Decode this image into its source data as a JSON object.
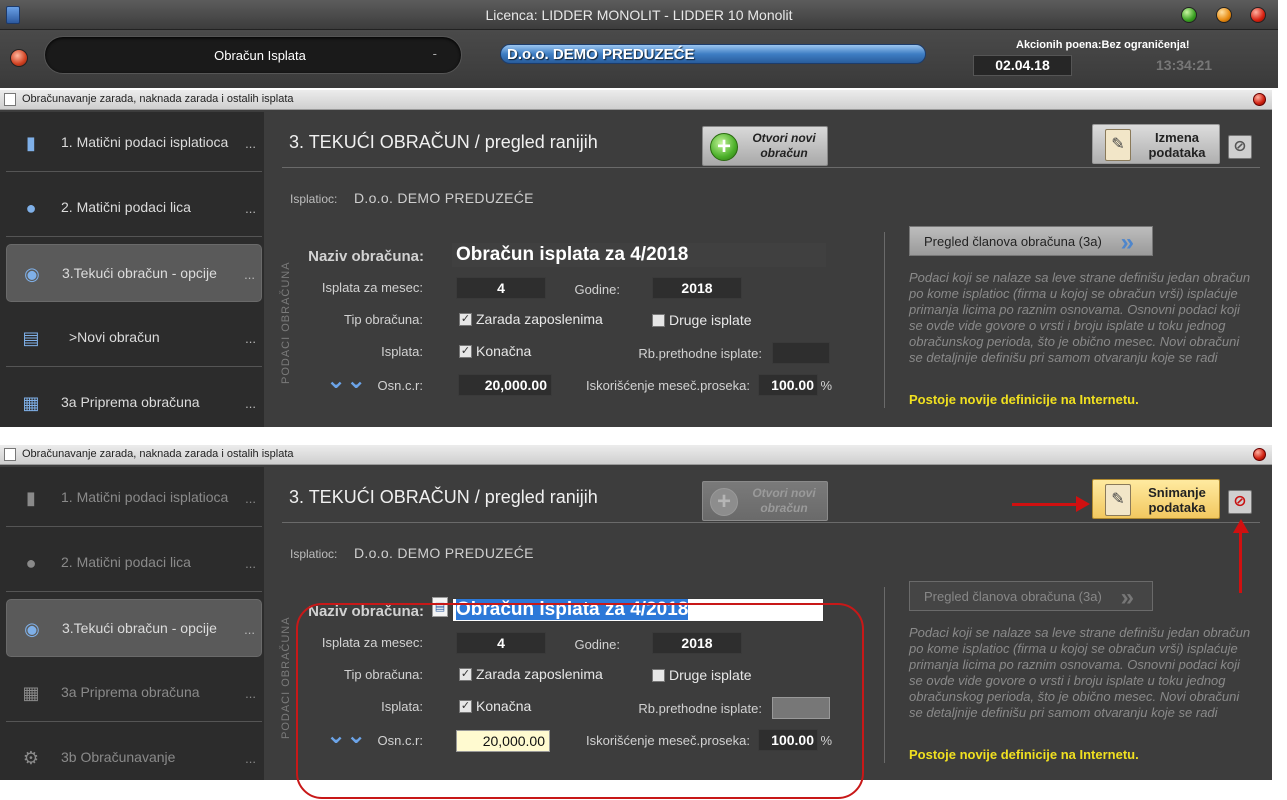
{
  "app": {
    "title": "Licenca: LIDDER MONOLIT - LIDDER 10 Monolit",
    "module": "Obračun Isplata",
    "module_dash": "-",
    "company": "D.o.o. DEMO PREDUZEĆE",
    "points_label": "Akcionih poena:Bez ograničenja!",
    "date": "02.04.18",
    "time": "13:34:21"
  },
  "window": {
    "title": "Obračunavanje zarada, naknada zarada i ostalih isplata"
  },
  "sidebar_top": [
    {
      "label": "1. Matični podaci isplatioca",
      "dots": "...",
      "icon": "bottle-icon"
    },
    {
      "label": "2. Matični podaci lica",
      "dots": "...",
      "icon": "person-icon"
    },
    {
      "label": "3.Tekući obračun - opcije",
      "dots": "...",
      "icon": "database-check-icon",
      "active": true
    },
    {
      "label": ">Novi obračun",
      "dots": "...",
      "icon": "calculator-icon"
    },
    {
      "label": "3a Priprema obračuna",
      "dots": "...",
      "icon": "table-db-icon"
    }
  ],
  "sidebar_bottom": [
    {
      "label": "1. Matični podaci isplatioca",
      "dots": "...",
      "icon": "bottle-icon"
    },
    {
      "label": "2. Matični podaci lica",
      "dots": "...",
      "icon": "person-icon"
    },
    {
      "label": "3.Tekući obračun - opcije",
      "dots": "...",
      "icon": "database-check-icon",
      "active": true
    },
    {
      "label": "3a Priprema obračuna",
      "dots": "...",
      "icon": "table-db-icon"
    },
    {
      "label": "3b Obračunavanje",
      "dots": "...",
      "icon": "database-gear-icon"
    }
  ],
  "main": {
    "heading": "3. TEKUĆI OBRAČUN / pregled ranijih",
    "new_btn_line1": "Otvori novi",
    "new_btn_line2": "obračun",
    "edit_btn_line1": "Izmena",
    "edit_btn_line2": "podataka",
    "save_btn_line1": "Snimanje",
    "save_btn_line2": "podataka",
    "cancel_symbol": "⊘",
    "payer_label": "Isplatioc:",
    "payer_value": "D.o.o. DEMO PREDUZEĆE",
    "side_caption": "PODACI OBRAČUNA",
    "naziv_label": "Naziv obračuna:",
    "naziv_value": "Obračun isplata za 4/2018",
    "mesec_label": "Isplata za mesec:",
    "mesec_value": "4",
    "godine_label": "Godine:",
    "godine_value": "2018",
    "tip_label": "Tip obračuna:",
    "zarada_label": "Zarada zaposlenima",
    "druge_label": "Druge isplate",
    "isplata_label": "Isplata:",
    "konacna_label": "Konačna",
    "rb_label": "Rb.prethodne isplate:",
    "osn_label": "Osn.c.r:",
    "osn_value": "20,000.00",
    "isk_label": "Iskorišćenje meseč.proseka:",
    "isk_value": "100.00",
    "isk_unit": "%",
    "members_btn": "Pregled članova obračuna (3a)",
    "members_arrows": "»",
    "info_text": "Podaci koji se nalaze sa leve strane definišu jedan obračun po kome isplatioc (firma u kojoj se obračun vrši) isplaćuje primanja licima po raznim osnovama. Osnovni podaci koji se ovde vide govore o vrsti i broju isplate u toku jednog obračunskog perioda, što je obično mesec. Novi obračuni se detaljnije definišu pri samom otvaranju koje se radi",
    "internet_note": "Postoje novije definicije na Internetu.",
    "check_mark": "✓",
    "plus_symbol": "+",
    "down_symbol": "⌄⌄"
  },
  "colors": {
    "background": "#3d3d3d",
    "sidebar": "#2c2c2c",
    "accent_blue": "#3e7ec4",
    "note_yellow": "#f0e020",
    "annotation_red": "#c81818"
  }
}
